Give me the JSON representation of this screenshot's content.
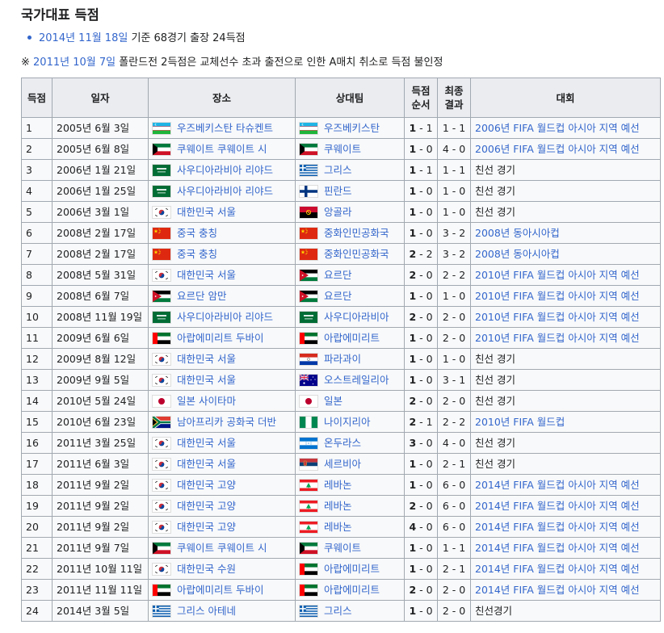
{
  "heading": "국가대표 득점",
  "summary": {
    "date_link": "2014년 11월 18일",
    "rest": " 기준 68경기 출장 24득점"
  },
  "note": {
    "prefix": "※ ",
    "date_link": "2011년 10월 7일",
    "rest": " 폴란드전 2득점은 교체선수 초과 출전으로 인한 A매치 취소로 득점 불인정"
  },
  "columns": {
    "goal": "득점",
    "date": "일자",
    "venue": "장소",
    "opponent": "상대팀",
    "score_1": "득점",
    "score_2": "순서",
    "result_1": "최종",
    "result_2": "결과",
    "competition": "대회"
  },
  "colors": {
    "link": "#3366cc",
    "header_bg": "#eaecf0",
    "cell_bg": "#f8f9fa",
    "border": "#a2a9b1"
  },
  "rows": [
    {
      "no": "1",
      "date": "2005년 6월 3일",
      "venue": "우즈베키스탄 타슈켄트",
      "venue_flag": "uzbekistan-flag",
      "opp": "우즈베키스탄",
      "opp_flag": "uzbekistan-flag",
      "s1": "1",
      "s2": "1",
      "r": "1 - 1",
      "comp": "2006년 FIFA 월드컵 아시아 지역 예선",
      "comp_link": true
    },
    {
      "no": "2",
      "date": "2005년 6월 8일",
      "venue": "쿠웨이트 쿠웨이트 시",
      "venue_flag": "kuwait-flag",
      "opp": "쿠웨이트",
      "opp_flag": "kuwait-flag",
      "s1": "1",
      "s2": "0",
      "r": "4 - 0",
      "comp": "2006년 FIFA 월드컵 아시아 지역 예선",
      "comp_link": true
    },
    {
      "no": "3",
      "date": "2006년 1월 21일",
      "venue": "사우디아라비아 리야드",
      "venue_flag": "saudi-arabia-flag",
      "opp": "그리스",
      "opp_flag": "greece-flag",
      "s1": "1",
      "s2": "1",
      "r": "1 - 1",
      "comp": "친선 경기",
      "comp_link": false
    },
    {
      "no": "4",
      "date": "2006년 1월 25일",
      "venue": "사우디아라비아 리야드",
      "venue_flag": "saudi-arabia-flag",
      "opp": "핀란드",
      "opp_flag": "finland-flag",
      "s1": "1",
      "s2": "0",
      "r": "1 - 0",
      "comp": "친선 경기",
      "comp_link": false
    },
    {
      "no": "5",
      "date": "2006년 3월 1일",
      "venue": "대한민국 서울",
      "venue_flag": "south-korea-flag",
      "opp": "앙골라",
      "opp_flag": "angola-flag",
      "s1": "1",
      "s2": "0",
      "r": "1 - 0",
      "comp": "친선 경기",
      "comp_link": false
    },
    {
      "no": "6",
      "date": "2008년 2월 17일",
      "venue": "중국 충칭",
      "venue_flag": "china-flag",
      "opp": "중화인민공화국",
      "opp_flag": "china-flag",
      "s1": "1",
      "s2": "0",
      "r": "3 - 2",
      "comp": "2008년 동아시아컵",
      "comp_link": true
    },
    {
      "no": "7",
      "date": "2008년 2월 17일",
      "venue": "중국 충칭",
      "venue_flag": "china-flag",
      "opp": "중화인민공화국",
      "opp_flag": "china-flag",
      "s1": "2",
      "s2": "2",
      "r": "3 - 2",
      "comp": "2008년 동아시아컵",
      "comp_link": true
    },
    {
      "no": "8",
      "date": "2008년 5월 31일",
      "venue": "대한민국 서울",
      "venue_flag": "south-korea-flag",
      "opp": "요르단",
      "opp_flag": "jordan-flag",
      "s1": "2",
      "s2": "0",
      "r": "2 - 2",
      "comp": "2010년 FIFA 월드컵 아시아 지역 예선",
      "comp_link": true
    },
    {
      "no": "9",
      "date": "2008년 6월 7일",
      "venue": "요르단 암만",
      "venue_flag": "jordan-flag",
      "opp": "요르단",
      "opp_flag": "jordan-flag",
      "s1": "1",
      "s2": "0",
      "r": "1 - 0",
      "comp": "2010년 FIFA 월드컵 아시아 지역 예선",
      "comp_link": true
    },
    {
      "no": "10",
      "date": "2008년 11월 19일",
      "venue": "사우디아라비아 리야드",
      "venue_flag": "saudi-arabia-flag",
      "opp": "사우디아라비아",
      "opp_flag": "saudi-arabia-flag",
      "s1": "2",
      "s2": "0",
      "r": "2 - 0",
      "comp": "2010년 FIFA 월드컵 아시아 지역 예선",
      "comp_link": true
    },
    {
      "no": "11",
      "date": "2009년 6월 6일",
      "venue": "아랍에미리트 두바이",
      "venue_flag": "uae-flag",
      "opp": "아랍에미리트",
      "opp_flag": "uae-flag",
      "s1": "1",
      "s2": "0",
      "r": "2 - 0",
      "comp": "2010년 FIFA 월드컵 아시아 지역 예선",
      "comp_link": true
    },
    {
      "no": "12",
      "date": "2009년 8월 12일",
      "venue": "대한민국 서울",
      "venue_flag": "south-korea-flag",
      "opp": "파라과이",
      "opp_flag": "paraguay-flag",
      "s1": "1",
      "s2": "0",
      "r": "1 - 0",
      "comp": "친선 경기",
      "comp_link": false
    },
    {
      "no": "13",
      "date": "2009년 9월 5일",
      "venue": "대한민국 서울",
      "venue_flag": "south-korea-flag",
      "opp": "오스트레일리아",
      "opp_flag": "australia-flag",
      "s1": "1",
      "s2": "0",
      "r": "3 - 1",
      "comp": "친선 경기",
      "comp_link": false
    },
    {
      "no": "14",
      "date": "2010년 5월 24일",
      "venue": "일본 사이타마",
      "venue_flag": "japan-flag",
      "opp": "일본",
      "opp_flag": "japan-flag",
      "s1": "2",
      "s2": "0",
      "r": "2 - 0",
      "comp": "친선 경기",
      "comp_link": false
    },
    {
      "no": "15",
      "date": "2010년 6월 23일",
      "venue": "남아프리카 공화국 더반",
      "venue_flag": "south-africa-flag",
      "opp": "나이지리아",
      "opp_flag": "nigeria-flag",
      "s1": "2",
      "s2": "1",
      "r": "2 - 2",
      "comp": "2010년 FIFA 월드컵",
      "comp_link": true
    },
    {
      "no": "16",
      "date": "2011년 3월 25일",
      "venue": "대한민국 서울",
      "venue_flag": "south-korea-flag",
      "opp": "온두라스",
      "opp_flag": "honduras-flag",
      "s1": "3",
      "s2": "0",
      "r": "4 - 0",
      "comp": "친선 경기",
      "comp_link": false
    },
    {
      "no": "17",
      "date": "2011년 6월 3일",
      "venue": "대한민국 서울",
      "venue_flag": "south-korea-flag",
      "opp": "세르비아",
      "opp_flag": "serbia-flag",
      "s1": "1",
      "s2": "0",
      "r": "2 - 1",
      "comp": "친선 경기",
      "comp_link": false
    },
    {
      "no": "18",
      "date": "2011년 9월 2일",
      "venue": "대한민국 고양",
      "venue_flag": "south-korea-flag",
      "opp": "레바논",
      "opp_flag": "lebanon-flag",
      "s1": "1",
      "s2": "0",
      "r": "6 - 0",
      "comp": "2014년 FIFA 월드컵 아시아 지역 예선",
      "comp_link": true
    },
    {
      "no": "19",
      "date": "2011년 9월 2일",
      "venue": "대한민국 고양",
      "venue_flag": "south-korea-flag",
      "opp": "레바논",
      "opp_flag": "lebanon-flag",
      "s1": "2",
      "s2": "0",
      "r": "6 - 0",
      "comp": "2014년 FIFA 월드컵 아시아 지역 예선",
      "comp_link": true
    },
    {
      "no": "20",
      "date": "2011년 9월 2일",
      "venue": "대한민국 고양",
      "venue_flag": "south-korea-flag",
      "opp": "레바논",
      "opp_flag": "lebanon-flag",
      "s1": "4",
      "s2": "0",
      "r": "6 - 0",
      "comp": "2014년 FIFA 월드컵 아시아 지역 예선",
      "comp_link": true
    },
    {
      "no": "21",
      "date": "2011년 9월 7일",
      "venue": "쿠웨이트 쿠웨이트 시",
      "venue_flag": "kuwait-flag",
      "opp": "쿠웨이트",
      "opp_flag": "kuwait-flag",
      "s1": "1",
      "s2": "0",
      "r": "1 - 1",
      "comp": "2014년 FIFA 월드컵 아시아 지역 예선",
      "comp_link": true
    },
    {
      "no": "22",
      "date": "2011년 10월 11일",
      "venue": "대한민국 수원",
      "venue_flag": "south-korea-flag",
      "opp": "아랍에미리트",
      "opp_flag": "uae-flag",
      "s1": "1",
      "s2": "0",
      "r": "2 - 1",
      "comp": "2014년 FIFA 월드컵 아시아 지역 예선",
      "comp_link": true
    },
    {
      "no": "23",
      "date": "2011년 11월 11일",
      "venue": "아랍에미리트 두바이",
      "venue_flag": "uae-flag",
      "opp": "아랍에미리트",
      "opp_flag": "uae-flag",
      "s1": "2",
      "s2": "0",
      "r": "2 - 0",
      "comp": "2014년 FIFA 월드컵 아시아 지역 예선",
      "comp_link": true
    },
    {
      "no": "24",
      "date": "2014년 3월 5일",
      "venue": "그리스 아테네",
      "venue_flag": "greece-flag",
      "opp": "그리스",
      "opp_flag": "greece-flag",
      "s1": "1",
      "s2": "0",
      "r": "2 - 0",
      "comp": "친선경기",
      "comp_link": false
    }
  ]
}
